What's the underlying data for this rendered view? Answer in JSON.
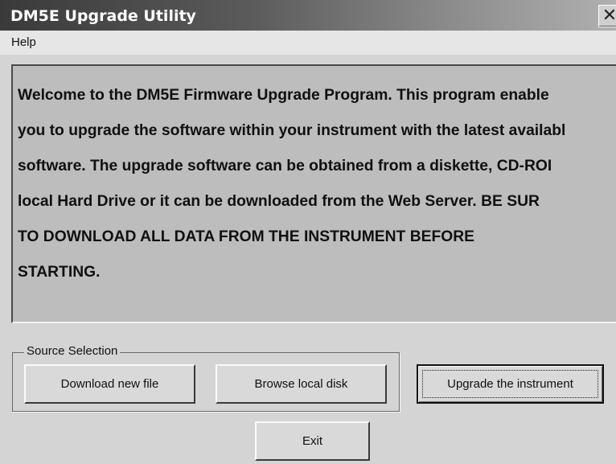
{
  "window": {
    "title": "DM5E Upgrade Utility",
    "close_glyph": "✕"
  },
  "menu": {
    "items": [
      "Help"
    ]
  },
  "message": {
    "lines": [
      "Welcome to the DM5E Firmware Upgrade Program. This program enable",
      "you to upgrade the software within your instrument with the latest availabl",
      "software. The upgrade software can be obtained from a diskette, CD-ROI",
      "local Hard Drive or it can be downloaded from the Web Server.  BE SUR",
      "TO DOWNLOAD ALL DATA FROM THE INSTRUMENT BEFORE",
      "STARTING."
    ]
  },
  "source_selection": {
    "label": "Source Selection",
    "download_label": "Download new file",
    "browse_label": "Browse local disk"
  },
  "actions": {
    "upgrade_label": "Upgrade the instrument",
    "exit_label": "Exit"
  }
}
